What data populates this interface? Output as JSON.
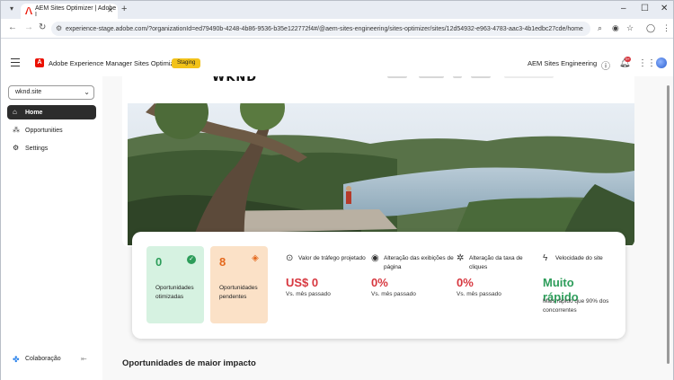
{
  "browser": {
    "tab_title": "AEM Sites Optimizer | Adobe I",
    "url": "experience-stage.adobe.com/?organizationId=ed79490b-4248-4b86-9536-b35e122772f4#/@aem-sites-engineering/sites-optimizer/sites/12d54932-e963-4783-aac3-4b1edbc27cde/home"
  },
  "header": {
    "app_title": "Adobe Experience Manager Sites Optimizer",
    "env_badge": "Staging",
    "org_name": "AEM Sites Engineering",
    "notif_count": "9+"
  },
  "sidebar": {
    "site_selector": "wknd.site",
    "items": [
      {
        "label": "Home"
      },
      {
        "label": "Opportunities"
      },
      {
        "label": "Settings"
      }
    ],
    "collab_label": "Colaboração"
  },
  "preview": {
    "brand": "WKND"
  },
  "stats": {
    "optimized": {
      "value": "0",
      "label": "Oportunidades otimizadas"
    },
    "pending": {
      "value": "8",
      "label": "Oportunidades pendentes"
    },
    "traffic": {
      "label": "Valor de tráfego projetado",
      "value": "US$ 0",
      "sub": "Vs. mês passado"
    },
    "pageviews": {
      "label": "Alteração das exibições de página",
      "value": "0%",
      "sub": "Vs. mês passado"
    },
    "clicks": {
      "label": "Alteração da taxa de cliques",
      "value": "0%",
      "sub": "Vs. mês passado"
    },
    "speed": {
      "label": "Velocidade do site",
      "value": "Muito rápido",
      "sub": "Mais rápido que 90% dos concorrentes"
    }
  },
  "section": {
    "title": "Oportunidades de maior impacto"
  },
  "colors": {
    "accent_green": "#2d9d5a",
    "accent_red": "#d7373f",
    "accent_orange": "#e4681c",
    "badge_yellow": "#f2c21a"
  }
}
